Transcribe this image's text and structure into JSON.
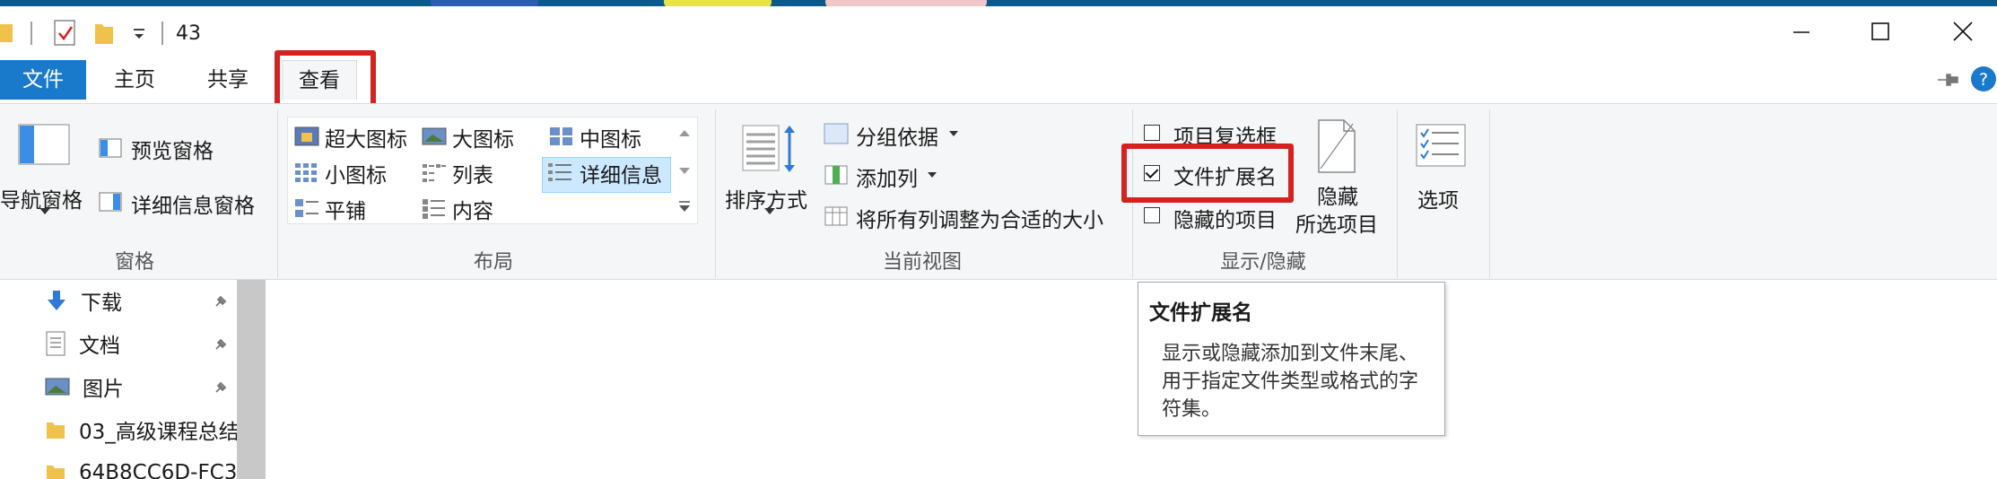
{
  "window": {
    "title": "43",
    "controls": [
      "minimize",
      "maximize",
      "close"
    ]
  },
  "tabs": [
    {
      "label": "文件",
      "active": false,
      "accent": true
    },
    {
      "label": "主页",
      "active": false
    },
    {
      "label": "共享",
      "active": false
    },
    {
      "label": "查看",
      "active": true
    }
  ],
  "ribbon": {
    "panes": {
      "label": "窗格",
      "nav_pane": "导航窗格",
      "preview_pane": "预览窗格",
      "details_pane": "详细信息窗格"
    },
    "layout": {
      "label": "布局",
      "items": [
        "超大图标",
        "大图标",
        "中图标",
        "小图标",
        "列表",
        "详细信息",
        "平铺",
        "内容"
      ],
      "selected": "详细信息"
    },
    "current_view": {
      "label": "当前视图",
      "sort_by": "排序方式",
      "group_by": "分组依据",
      "add_columns": "添加列",
      "size_all_columns": "将所有列调整为合适的大小"
    },
    "show_hide": {
      "label": "显示/隐藏",
      "item_checkboxes": {
        "label": "项目复选框",
        "checked": false
      },
      "file_name_extensions": {
        "label": "文件扩展名",
        "checked": true
      },
      "hidden_items": {
        "label": "隐藏的项目",
        "checked": false
      },
      "hide_selected_line1": "隐藏",
      "hide_selected_line2": "所选项目"
    },
    "options": {
      "label": "选项"
    }
  },
  "nav_items": [
    {
      "label": "下载",
      "icon": "download-arrow-icon",
      "pinned": true
    },
    {
      "label": "文档",
      "icon": "document-icon",
      "pinned": true
    },
    {
      "label": "图片",
      "icon": "picture-icon",
      "pinned": true
    },
    {
      "label": "03_高级课程总结",
      "icon": "folder-icon",
      "pinned": false
    },
    {
      "label": "64B8CC6D-FC3",
      "icon": "folder-icon",
      "pinned": false
    }
  ],
  "tooltip": {
    "title": "文件扩展名",
    "body": "显示或隐藏添加到文件末尾、用于指定文件类型或格式的字符集。"
  },
  "colors": {
    "accent": "#1979ca",
    "highlight": "#d4221f",
    "ribbon_bg": "#f5f6f7",
    "selected_item_bg": "#cce8ff"
  }
}
